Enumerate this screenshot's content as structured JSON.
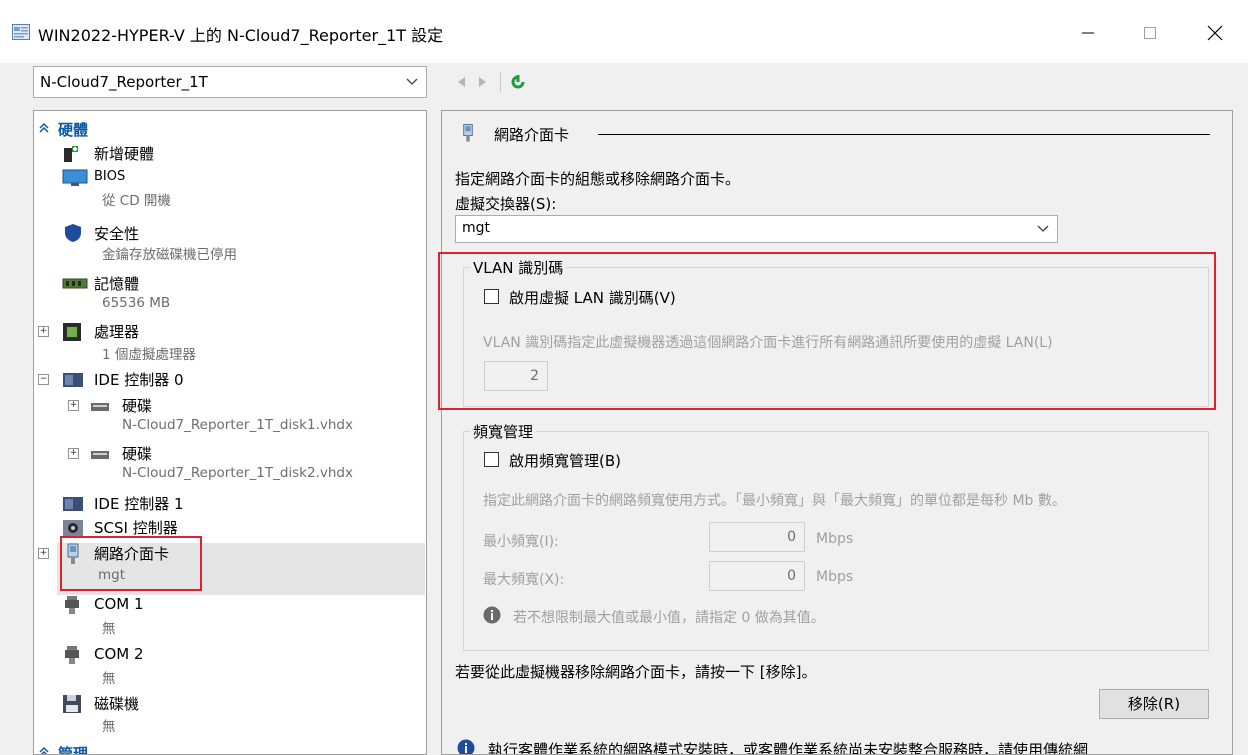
{
  "window": {
    "title": "WIN2022-HYPER-V 上的 N-Cloud7_Reporter_1T 設定",
    "controls": {
      "minimize": "—",
      "maximize": "☐",
      "close": "✕"
    }
  },
  "vm_selector": {
    "value": "N-Cloud7_Reporter_1T"
  },
  "tree": {
    "hardware_header": "硬體",
    "add_hardware": "新增硬體",
    "bios": {
      "label": "BIOS",
      "sub": "從 CD 開機"
    },
    "security": {
      "label": "安全性",
      "sub": "金鑰存放磁碟機已停用"
    },
    "memory": {
      "label": "記憶體",
      "sub": "65536 MB"
    },
    "processor": {
      "label": "處理器",
      "sub": "1 個虛擬處理器"
    },
    "ide0": {
      "label": "IDE 控制器 0"
    },
    "disk1": {
      "label": "硬碟",
      "sub": "N-Cloud7_Reporter_1T_disk1.vhdx"
    },
    "disk2": {
      "label": "硬碟",
      "sub": "N-Cloud7_Reporter_1T_disk2.vhdx"
    },
    "ide1": {
      "label": "IDE 控制器 1"
    },
    "scsi": {
      "label": "SCSI 控制器"
    },
    "nic": {
      "label": "網路介面卡",
      "sub": "mgt"
    },
    "com1": {
      "label": "COM 1",
      "sub": "無"
    },
    "com2": {
      "label": "COM 2",
      "sub": "無"
    },
    "floppy": {
      "label": "磁碟機",
      "sub": "無"
    },
    "management_header": "管理"
  },
  "nic_panel": {
    "title": "網路介面卡",
    "desc": "指定網路介面卡的組態或移除網路介面卡。",
    "switch_label": "虛擬交換器(S):",
    "switch_value": "mgt",
    "vlan": {
      "group_title": "VLAN 識別碼",
      "checkbox_label": "啟用虛擬 LAN 識別碼(V)",
      "desc": "VLAN 識別碼指定此虛擬機器透過這個網路介面卡進行所有網路通訊所要使用的虛擬 LAN(L)",
      "value": "2"
    },
    "bandwidth": {
      "group_title": "頻寬管理",
      "checkbox_label": "啟用頻寬管理(B)",
      "desc": "指定此網路介面卡的網路頻寬使用方式。「最小頻寬」與「最大頻寬」的單位都是每秒 Mb 數。",
      "min_label": "最小頻寬(I):",
      "min_value": "0",
      "max_label": "最大頻寬(X):",
      "max_value": "0",
      "unit": "Mbps",
      "info": "若不想限制最大值或最小值，請指定 0 做為其值。"
    },
    "remove_desc": "若要從此虛擬機器移除網路介面卡，請按一下 [移除]。",
    "remove_button": "移除(R)",
    "bottom_info": "執行客體作業系統的網路模式安裝時，或客體作業系統尚未安裝整合服務時，請使用傳統網"
  },
  "colors": {
    "highlight": "#d9232f",
    "accent": "#0b5aa8",
    "green": "#1e9b3a"
  }
}
